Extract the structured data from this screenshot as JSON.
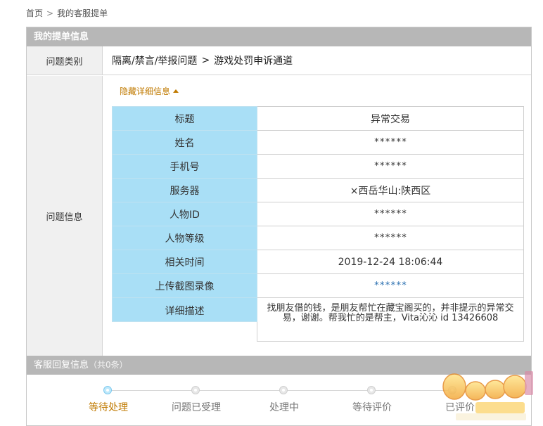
{
  "breadcrumb": {
    "home": "首页",
    "separator": ">",
    "current": "我的客服提单"
  },
  "panel": {
    "title": "我的提单信息"
  },
  "category": {
    "label": "问题类别",
    "path": "隔离/禁言/举报问题",
    "arrow": ">",
    "leaf": "游戏处罚申诉通道"
  },
  "info": {
    "label": "问题信息",
    "toggle": "隐藏详细信息",
    "rows": [
      {
        "key": "标题",
        "value": "异常交易"
      },
      {
        "key": "姓名",
        "value": "******"
      },
      {
        "key": "手机号",
        "value": "******"
      },
      {
        "key": "服务器",
        "value": "×西岳华山:陕西区"
      },
      {
        "key": "人物ID",
        "value": "******"
      },
      {
        "key": "人物等级",
        "value": "******"
      },
      {
        "key": "相关时间",
        "value": "2019-12-24 18:06:44"
      },
      {
        "key": "上传截图录像",
        "value": "******"
      },
      {
        "key": "详细描述",
        "value": "找朋友借的钱，是朋友帮忙在藏宝阁买的，并非提示的异常交易，谢谢。帮我忙的是帮主，Vita沁沁 id 13426608"
      }
    ]
  },
  "reply": {
    "title": "客服回复信息",
    "count": "（共0条）"
  },
  "steps": [
    {
      "label": "等待处理",
      "active": true
    },
    {
      "label": "问题已受理",
      "active": false
    },
    {
      "label": "处理中",
      "active": false
    },
    {
      "label": "等待评价",
      "active": false
    },
    {
      "label": "已评价",
      "active": false
    }
  ],
  "watermark": {
    "brand": "梦幻西游",
    "sub": "xyq.netease.com"
  },
  "colors": {
    "accent": "#c07a00",
    "header_gray": "#b7b7b7",
    "key_cell": "#a9dff6",
    "link": "#2a6fb0"
  }
}
